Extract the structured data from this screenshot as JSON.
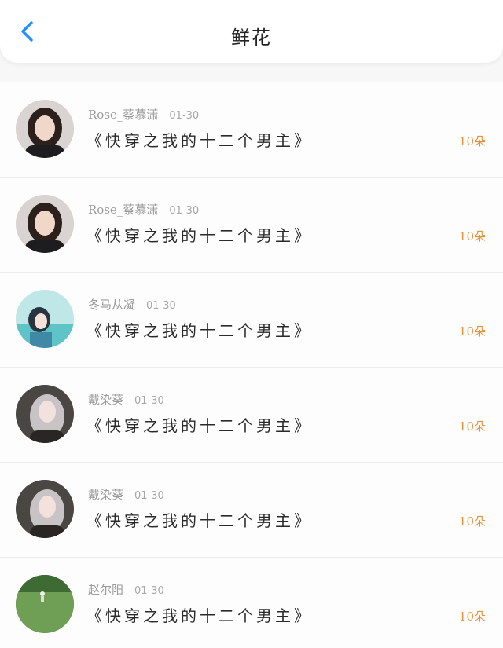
{
  "header": {
    "title": "鲜花",
    "back_icon": "chevron-left-icon",
    "accent": "#1e90ff"
  },
  "colors": {
    "count": "#e8913a",
    "meta": "#9a9a9a"
  },
  "items": [
    {
      "user": "Rose_蔡慕潇",
      "date": "01-30",
      "book": "《快穿之我的十二个男主》",
      "count": "10朵",
      "avatar": "girl-dark-hair"
    },
    {
      "user": "Rose_蔡慕潇",
      "date": "01-30",
      "book": "《快穿之我的十二个男主》",
      "count": "10朵",
      "avatar": "girl-dark-hair"
    },
    {
      "user": "冬马从凝",
      "date": "01-30",
      "book": "《快穿之我的十二个男主》",
      "count": "10朵",
      "avatar": "anime-teal"
    },
    {
      "user": "戴染葵",
      "date": "01-30",
      "book": "《快穿之我的十二个男主》",
      "count": "10朵",
      "avatar": "girl-silver-hair"
    },
    {
      "user": "戴染葵",
      "date": "01-30",
      "book": "《快穿之我的十二个男主》",
      "count": "10朵",
      "avatar": "girl-silver-hair"
    },
    {
      "user": "赵尔阳",
      "date": "01-30",
      "book": "《快穿之我的十二个男主》",
      "count": "10朵",
      "avatar": "green-field"
    }
  ]
}
